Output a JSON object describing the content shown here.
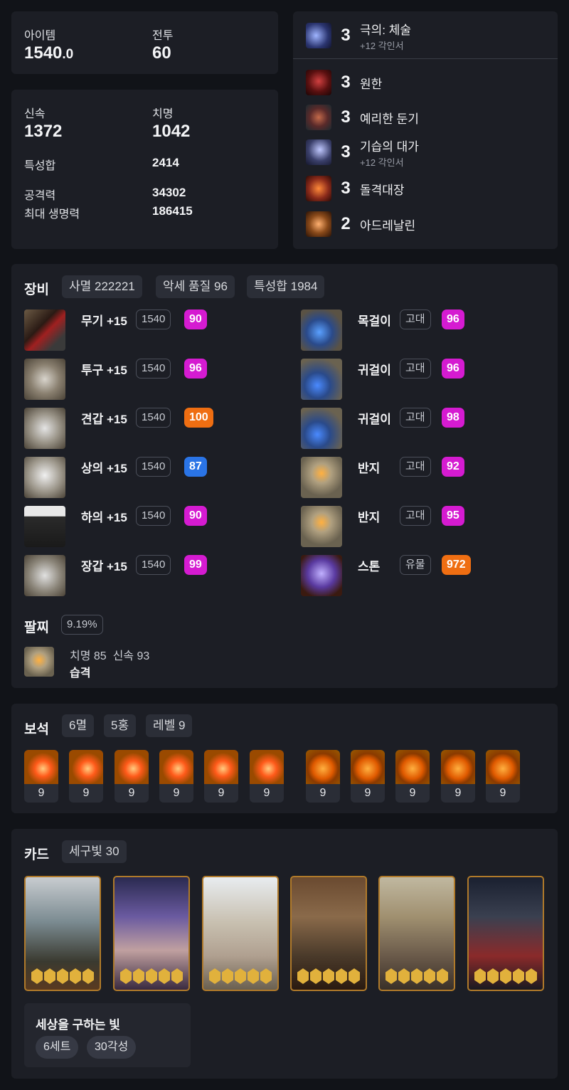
{
  "top_stats": {
    "item_label": "아이템",
    "item_value_main": "1540",
    "item_value_frac": ".0",
    "combat_label": "전투",
    "combat_value": "60"
  },
  "stats": {
    "swift_label": "신속",
    "swift_value": "1372",
    "crit_label": "치명",
    "crit_value": "1042",
    "total_label": "특성합",
    "total_value": "2414",
    "atk_label": "공격력",
    "atk_value": "34302",
    "hp_label": "최대 생명력",
    "hp_value": "186415"
  },
  "engravings": [
    {
      "level": "3",
      "name": "극의: 체술",
      "sub": "+12 각인서",
      "icon": "martial-icon",
      "color": "#3a4a8a"
    },
    {
      "level": "3",
      "name": "원한",
      "sub": "",
      "icon": "grudge-icon",
      "color": "#7a1f1f"
    },
    {
      "level": "3",
      "name": "예리한 둔기",
      "sub": "",
      "icon": "blunt-icon",
      "color": "#5a2a2a"
    },
    {
      "level": "3",
      "name": "기습의 대가",
      "sub": "+12 각인서",
      "icon": "ambush-icon",
      "color": "#3a3f6a"
    },
    {
      "level": "3",
      "name": "돌격대장",
      "sub": "",
      "icon": "raid-captain-icon",
      "color": "#8a2a1a"
    },
    {
      "level": "2",
      "name": "아드레날린",
      "sub": "",
      "icon": "adrenaline-icon",
      "color": "#6a3a1a"
    }
  ],
  "equipment": {
    "title": "장비",
    "chips": [
      "사멸 222221",
      "악세 품질 96",
      "특성합 1984"
    ],
    "left": [
      {
        "name": "무기 +15",
        "tag": "1540",
        "quality": "90",
        "qcolor": "#d51bd1",
        "icon": "weapon-icon"
      },
      {
        "name": "투구 +15",
        "tag": "1540",
        "quality": "96",
        "qcolor": "#d51bd1",
        "icon": "helmet-icon"
      },
      {
        "name": "견갑 +15",
        "tag": "1540",
        "quality": "100",
        "qcolor": "#ef6e12",
        "icon": "shoulder-icon"
      },
      {
        "name": "상의 +15",
        "tag": "1540",
        "quality": "87",
        "qcolor": "#2a74e6",
        "icon": "chest-icon"
      },
      {
        "name": "하의 +15",
        "tag": "1540",
        "quality": "90",
        "qcolor": "#d51bd1",
        "icon": "pants-icon"
      },
      {
        "name": "장갑 +15",
        "tag": "1540",
        "quality": "99",
        "qcolor": "#d51bd1",
        "icon": "gloves-icon"
      }
    ],
    "right": [
      {
        "name": "목걸이",
        "tag": "고대",
        "quality": "96",
        "qcolor": "#d51bd1",
        "icon": "necklace-icon"
      },
      {
        "name": "귀걸이",
        "tag": "고대",
        "quality": "96",
        "qcolor": "#d51bd1",
        "icon": "earring-icon"
      },
      {
        "name": "귀걸이",
        "tag": "고대",
        "quality": "98",
        "qcolor": "#d51bd1",
        "icon": "earring-icon"
      },
      {
        "name": "반지",
        "tag": "고대",
        "quality": "92",
        "qcolor": "#d51bd1",
        "icon": "ring-icon"
      },
      {
        "name": "반지",
        "tag": "고대",
        "quality": "95",
        "qcolor": "#d51bd1",
        "icon": "ring-icon"
      },
      {
        "name": "스톤",
        "tag": "유물",
        "quality": "972",
        "qcolor": "#ef6e12",
        "icon": "stone-icon"
      }
    ]
  },
  "bracelet": {
    "title": "팔찌",
    "chip": "9.19%",
    "line1": "치명 85  신속 93",
    "line2": "습격"
  },
  "gems": {
    "title": "보석",
    "chips": [
      "6멸",
      "5홍",
      "레벨 9"
    ],
    "levels": [
      "9",
      "9",
      "9",
      "9",
      "9",
      "9",
      "9",
      "9",
      "9",
      "9",
      "9"
    ]
  },
  "cards": {
    "title": "카드",
    "chip": "세구빛 30",
    "set_name": "세상을 구하는 빛",
    "set_chips": [
      "6세트",
      "30각성"
    ]
  }
}
